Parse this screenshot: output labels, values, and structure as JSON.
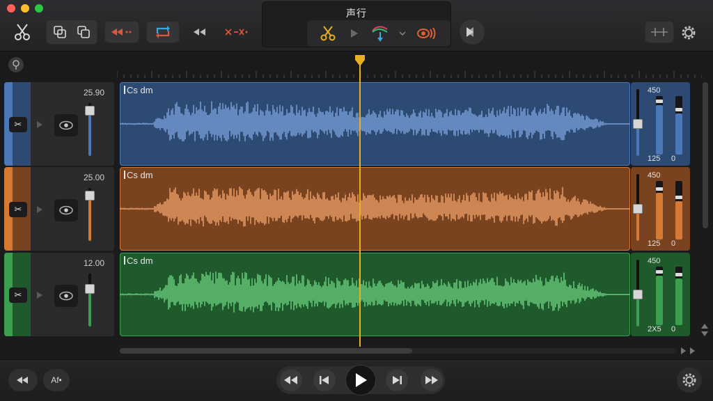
{
  "window": {
    "title": "声行"
  },
  "toolbar": {
    "icons": [
      "scissors-icon",
      "duplicate-icon",
      "copy-icon",
      "rewind-marker-icon",
      "loop-icon",
      "back-icon",
      "cut-marker-icon",
      "play-icon",
      "scissors-yellow-icon",
      "play-small-icon",
      "fade-icon",
      "chevron-down-icon",
      "broadcast-icon",
      "forward-icon",
      "settings-panel-icon",
      "gear-icon"
    ]
  },
  "tracks": [
    {
      "name": "Cs dm",
      "volume": "25.90",
      "meter_top": "450",
      "meter_bottom": "125",
      "meter_zero": "0",
      "color": "#4a78b8",
      "dark": "#2d4a72",
      "wave": "#7aa2dc",
      "fader_level": 0.4,
      "meter_l": 0.85,
      "meter_r": 0.7,
      "scissors_glyph": "✂"
    },
    {
      "name": "Cs dm",
      "volume": "25.00",
      "meter_top": "450",
      "meter_bottom": "125",
      "meter_zero": "0",
      "color": "#d47a34",
      "dark": "#7a4320",
      "wave": "#eea06a",
      "fader_level": 0.4,
      "meter_l": 0.8,
      "meter_r": 0.65,
      "scissors_glyph": "✂"
    },
    {
      "name": "Cs dm",
      "volume": "12.00",
      "meter_top": "450",
      "meter_bottom": "2X5",
      "meter_zero": "0",
      "color": "#3aa050",
      "dark": "#1f5a2c",
      "wave": "#6bd07e",
      "fader_level": 0.25,
      "meter_l": 0.85,
      "meter_r": 0.8,
      "scissors_glyph": "✂"
    }
  ],
  "transport": {
    "left_button_label": "Af•",
    "buttons": [
      "rewind-icon",
      "skip-back-icon",
      "play-icon",
      "skip-forward-icon",
      "fast-forward-icon"
    ]
  },
  "colors": {
    "playhead": "#e8b020",
    "background": "#1b1b1d"
  }
}
